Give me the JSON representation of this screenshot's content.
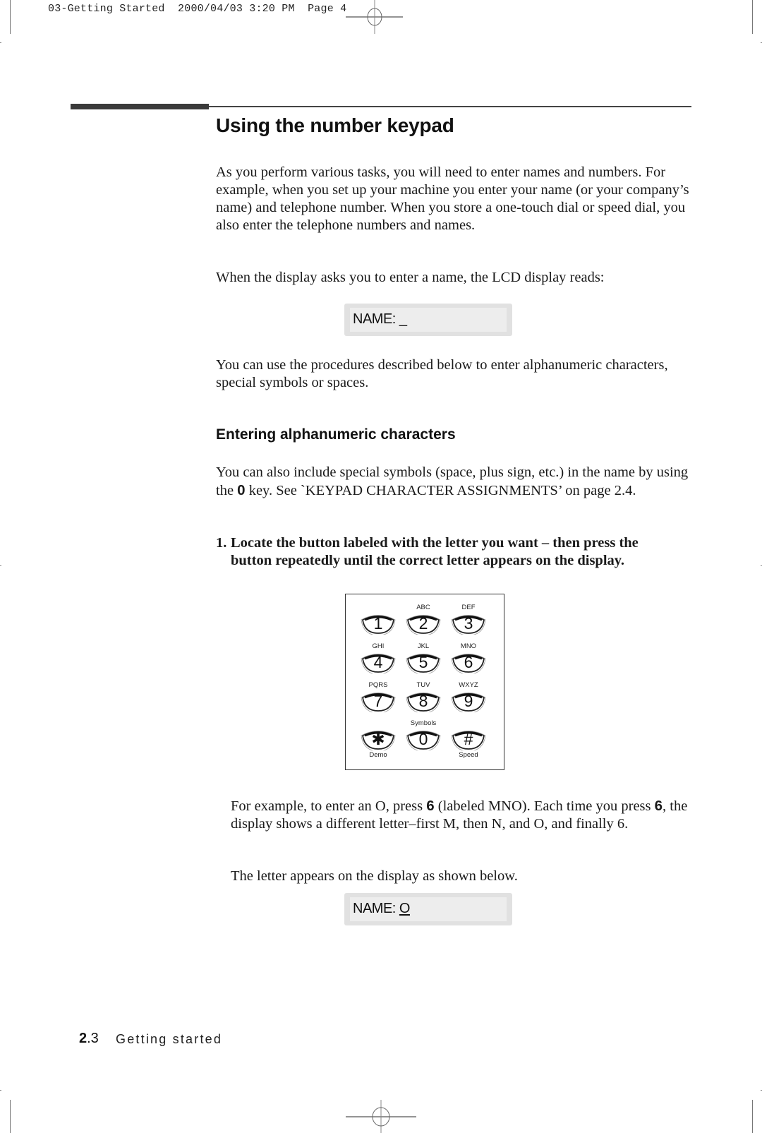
{
  "print_slug": {
    "file": "03-Getting Started",
    "date": "2000/04/03",
    "time": "3:20 PM",
    "page_label": "Page 4"
  },
  "section": {
    "title": "Using the number keypad",
    "intro": "As you perform various tasks, you will need to enter names and numbers. For example, when you set up your machine you enter your name (or your company’s name) and telephone number. When you store a one-touch dial or speed dial, you also enter the telephone numbers and names.",
    "lcd_prompt_text": "When the display asks you to enter a name, the LCD display reads:",
    "lcd_1": {
      "label": "NAME:",
      "cursor": "_"
    },
    "procedures_text": "You can use the procedures described below to enter alphanumeric characters, special symbols or spaces."
  },
  "subsection": {
    "title": "Entering alphanumeric characters",
    "para_before": "You can also include special symbols (space, plus sign, etc.) in the name by using the ",
    "para_key": "0",
    "para_after": " key. See `KEYPAD CHARACTER ASSIGNMENTS’ on page 2.4.",
    "step": {
      "number": "1.",
      "line1": "Locate the button labeled with the letter you want – then press the",
      "line2": "button repeatedly until the correct letter appears on the display."
    },
    "keypad": {
      "keys": [
        {
          "digit": "1",
          "top": "",
          "bottom": ""
        },
        {
          "digit": "2",
          "top": "ABC",
          "bottom": ""
        },
        {
          "digit": "3",
          "top": "DEF",
          "bottom": ""
        },
        {
          "digit": "4",
          "top": "GHI",
          "bottom": ""
        },
        {
          "digit": "5",
          "top": "JKL",
          "bottom": ""
        },
        {
          "digit": "6",
          "top": "MNO",
          "bottom": ""
        },
        {
          "digit": "7",
          "top": "PQRS",
          "bottom": ""
        },
        {
          "digit": "8",
          "top": "TUV",
          "bottom": ""
        },
        {
          "digit": "9",
          "top": "WXYZ",
          "bottom": ""
        },
        {
          "digit": "✱",
          "top": "",
          "bottom": "Demo"
        },
        {
          "digit": "0",
          "top": "Symbols",
          "bottom": ""
        },
        {
          "digit": "#",
          "top": "",
          "bottom": "Speed"
        }
      ]
    },
    "example": {
      "s1": "For example, to enter an O, press ",
      "k1": "6",
      "s2": " (labeled MNO). Each time you press ",
      "k2": "6",
      "s3": ", the display shows a different letter–first M, then N, and O, and finally 6."
    },
    "result_text": "The letter appears on the display as shown below.",
    "lcd_2": {
      "label": "NAME:",
      "cursor": "O"
    }
  },
  "footer": {
    "chapter": "2",
    "page": ".3",
    "label": "Getting started"
  }
}
